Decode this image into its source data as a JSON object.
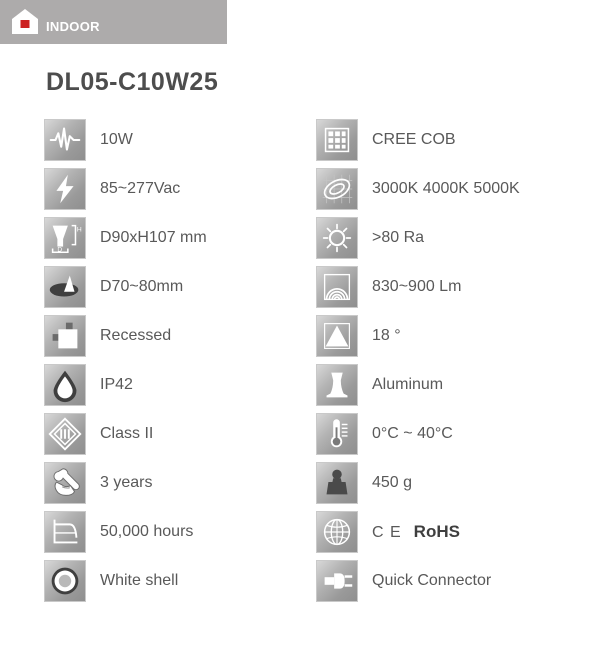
{
  "header": {
    "label": "INDOOR",
    "icon": "house-icon",
    "background_color": "#adabab",
    "accent_color": "#cc2222"
  },
  "product": {
    "title": "DL05-C10W25"
  },
  "specs": {
    "left_column": [
      {
        "icon": "power-waveform-icon",
        "value": "10W"
      },
      {
        "icon": "voltage-bolt-icon",
        "value": "85~277Vac"
      },
      {
        "icon": "dimensions-icon",
        "value": "D90xH107 mm"
      },
      {
        "icon": "cutout-hole-icon",
        "value": "D70~80mm"
      },
      {
        "icon": "recessed-mount-icon",
        "value": "Recessed"
      },
      {
        "icon": "waterdrop-ip-icon",
        "value": "IP42"
      },
      {
        "icon": "class-two-icon",
        "value": "Class II"
      },
      {
        "icon": "warranty-wrench-icon",
        "value": "3 years"
      },
      {
        "icon": "lifetime-graph-icon",
        "value": "50,000 hours"
      },
      {
        "icon": "shell-color-icon",
        "value": "White shell"
      }
    ],
    "right_column": [
      {
        "icon": "led-chip-grid-icon",
        "value": "CREE COB"
      },
      {
        "icon": "color-temperature-icon",
        "value": "3000K 4000K 5000K"
      },
      {
        "icon": "cri-sun-icon",
        "value": ">80 Ra"
      },
      {
        "icon": "luminous-flux-icon",
        "value": "830~900 Lm"
      },
      {
        "icon": "beam-angle-icon",
        "value": "18 °"
      },
      {
        "icon": "material-body-icon",
        "value": "Aluminum"
      },
      {
        "icon": "thermometer-icon",
        "value": "0°C ~ 40°C"
      },
      {
        "icon": "weight-icon",
        "value": "450 g"
      },
      {
        "icon": "globe-certification-icon",
        "value": "CE RoHS",
        "ce": "C E",
        "rohs": "RoHS"
      },
      {
        "icon": "quick-connector-icon",
        "value": "Quick Connector"
      }
    ]
  },
  "colors": {
    "text": "#595959",
    "title": "#4d4d4d",
    "icon_light": "#d8d8d8",
    "icon_dark": "#8f8f8f"
  }
}
